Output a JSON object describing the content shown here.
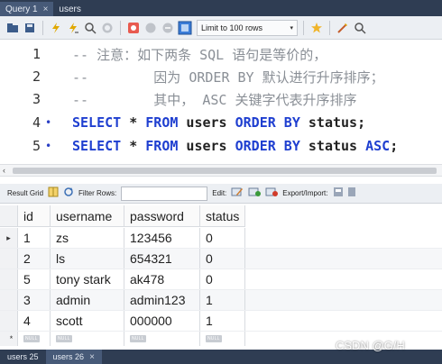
{
  "top_tabs": [
    {
      "label": "Query 1",
      "close": "×"
    },
    {
      "label": "users"
    }
  ],
  "toolbar": {
    "limit_label": "Limit to 100 rows",
    "caret": "▾"
  },
  "editor": {
    "lines": [
      {
        "num": "1",
        "dot": "",
        "tokens": [
          {
            "t": "-- 注意：如下两条 SQL 语句是等价的，",
            "c": "comment"
          }
        ]
      },
      {
        "num": "2",
        "dot": "",
        "tokens": [
          {
            "t": "--        因为 ORDER BY 默认进行升序排序；",
            "c": "comment"
          }
        ]
      },
      {
        "num": "3",
        "dot": "",
        "tokens": [
          {
            "t": "--        其中， ASC 关键字代表升序排序",
            "c": "comment"
          }
        ]
      },
      {
        "num": "4",
        "dot": "•",
        "tokens": [
          {
            "t": "SELECT",
            "c": "kw"
          },
          {
            "t": " * ",
            "c": "plain"
          },
          {
            "t": "FROM",
            "c": "kw"
          },
          {
            "t": " users ",
            "c": "plain"
          },
          {
            "t": "ORDER BY",
            "c": "kw"
          },
          {
            "t": " status;",
            "c": "plain"
          }
        ]
      },
      {
        "num": "5",
        "dot": "•",
        "tokens": [
          {
            "t": "SELECT",
            "c": "kw"
          },
          {
            "t": " * ",
            "c": "plain"
          },
          {
            "t": "FROM",
            "c": "kw"
          },
          {
            "t": " users ",
            "c": "plain"
          },
          {
            "t": "ORDER BY",
            "c": "kw"
          },
          {
            "t": " status ",
            "c": "plain"
          },
          {
            "t": "ASC",
            "c": "kw"
          },
          {
            "t": ";",
            "c": "plain"
          }
        ]
      }
    ]
  },
  "scroll": {
    "left_arrow": "‹"
  },
  "results_toolbar": {
    "result_grid": "Result Grid",
    "filter_rows": "Filter Rows:",
    "edit": "Edit:",
    "export_import": "Export/Import:"
  },
  "grid": {
    "columns": [
      "id",
      "username",
      "password",
      "status"
    ],
    "rows": [
      [
        "1",
        "zs",
        "123456",
        "0"
      ],
      [
        "2",
        "ls",
        "654321",
        "0"
      ],
      [
        "5",
        "tony stark",
        "ak478",
        "0"
      ],
      [
        "3",
        "admin",
        "admin123",
        "1"
      ],
      [
        "4",
        "scott",
        "000000",
        "1"
      ]
    ],
    "null_label": "NULL",
    "current_row_marker": "▸",
    "new_row_marker": "*"
  },
  "bottom_tabs": [
    {
      "label": "users 25"
    },
    {
      "label": "users 26",
      "close": "×"
    }
  ],
  "watermark": "CSDN @G/H",
  "colors": {
    "keyword": "#1f3fd0",
    "comment": "#8a8f96",
    "tab_bar": "#2f3d53",
    "tab_active": "#475a78"
  }
}
